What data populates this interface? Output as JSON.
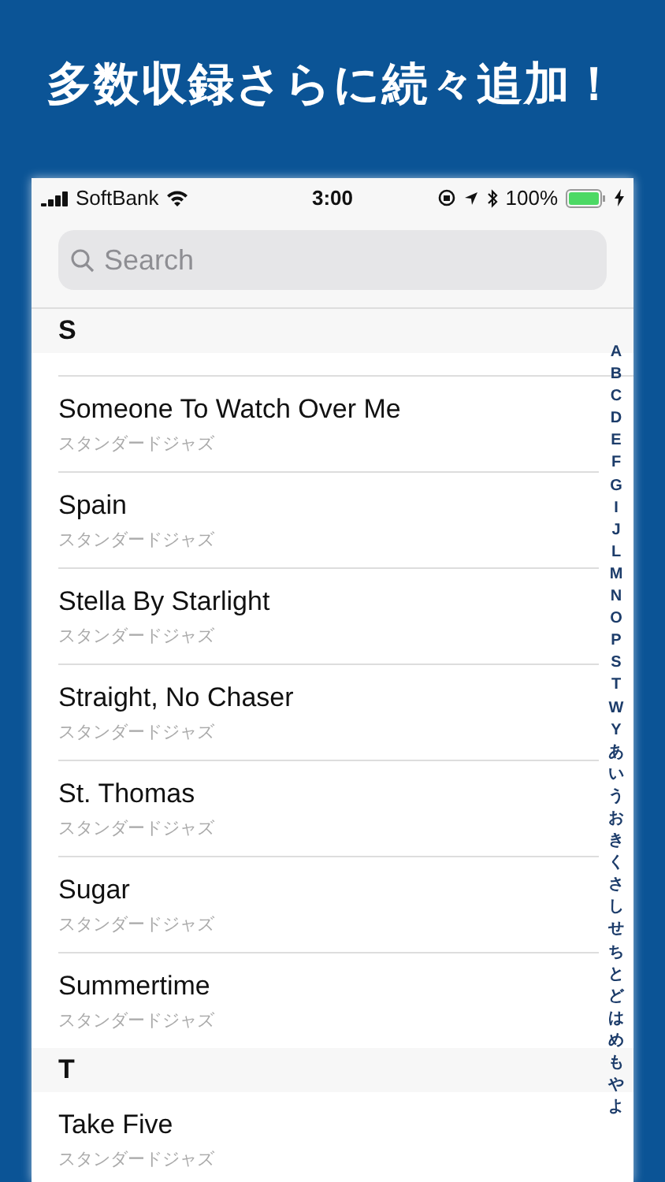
{
  "headline": "多数収録さらに続々追加！",
  "status_bar": {
    "carrier": "SoftBank",
    "time": "3:00",
    "battery": "100%"
  },
  "search": {
    "placeholder": "Search"
  },
  "sections": [
    {
      "header": "S",
      "partial_row": true,
      "rows": [
        {
          "title": "Someone To Watch Over Me",
          "subtitle": "スタンダードジャズ"
        },
        {
          "title": "Spain",
          "subtitle": "スタンダードジャズ"
        },
        {
          "title": "Stella By Starlight",
          "subtitle": "スタンダードジャズ"
        },
        {
          "title": "Straight, No Chaser",
          "subtitle": "スタンダードジャズ"
        },
        {
          "title": "St. Thomas",
          "subtitle": "スタンダードジャズ"
        },
        {
          "title": "Sugar",
          "subtitle": "スタンダードジャズ"
        },
        {
          "title": "Summertime",
          "subtitle": "スタンダードジャズ"
        }
      ]
    },
    {
      "header": "T",
      "partial_row": false,
      "rows": [
        {
          "title": "Take Five",
          "subtitle": "スタンダードジャズ"
        }
      ]
    }
  ],
  "index": [
    "A",
    "B",
    "C",
    "D",
    "E",
    "F",
    "G",
    "I",
    "J",
    "L",
    "M",
    "N",
    "O",
    "P",
    "S",
    "T",
    "W",
    "Y",
    "あ",
    "い",
    "う",
    "お",
    "き",
    "く",
    "さ",
    "し",
    "せ",
    "ち",
    "と",
    "ど",
    "は",
    "め",
    "も",
    "や",
    "よ"
  ]
}
